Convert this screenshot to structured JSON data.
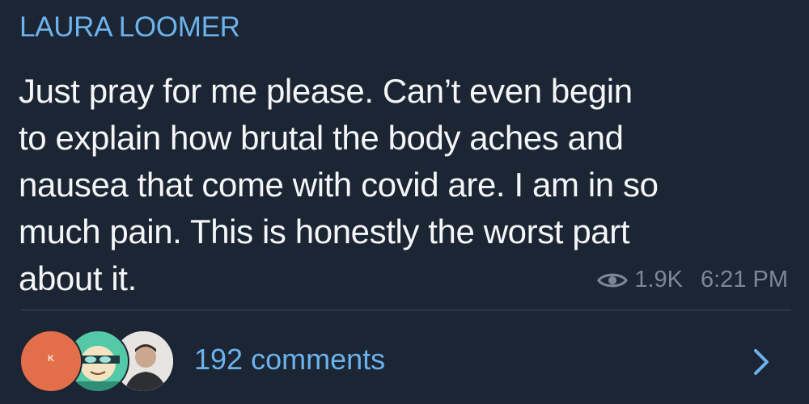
{
  "channel": {
    "name": "LAURA LOOMER"
  },
  "message": {
    "lines": [
      "Just pray for me please. Can’t even begin",
      "to explain how brutal the body aches and",
      "nausea that come with covid are. I am in so",
      "much pain. This is honestly the worst part",
      "about it."
    ],
    "views": "1.9K",
    "time": "6:21 PM",
    "views_icon": "eye-icon"
  },
  "comments": {
    "label": "192 comments",
    "avatar_initial": "K",
    "open_icon": "chevron-right-icon"
  },
  "colors": {
    "background": "#1c2533",
    "accent": "#6cb2ec",
    "text": "#f4f6f8",
    "meta": "#7c8897",
    "avatar_1": "#e26f4a",
    "avatar_2": "#55c8a8"
  }
}
